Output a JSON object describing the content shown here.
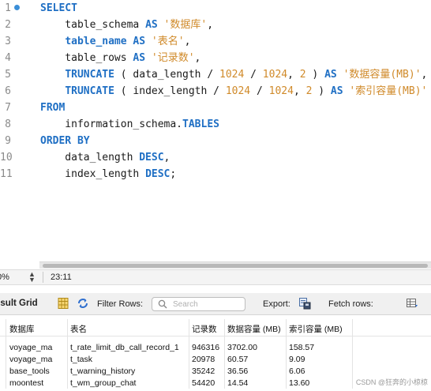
{
  "editor": {
    "lines": [
      {
        "n": "1",
        "breakpoint": true,
        "tokens": [
          {
            "t": "kw",
            "v": "SELECT"
          }
        ]
      },
      {
        "n": "2",
        "tokens": [
          {
            "t": "p",
            "v": "    table_schema "
          },
          {
            "t": "kw",
            "v": "AS"
          },
          {
            "t": "p",
            "v": " "
          },
          {
            "t": "str",
            "v": "'数据库'"
          },
          {
            "t": "p",
            "v": ","
          }
        ]
      },
      {
        "n": "3",
        "tokens": [
          {
            "t": "p",
            "v": "    "
          },
          {
            "t": "kw",
            "v": "table_name"
          },
          {
            "t": "p",
            "v": " "
          },
          {
            "t": "kw",
            "v": "AS"
          },
          {
            "t": "p",
            "v": " "
          },
          {
            "t": "str",
            "v": "'表名'"
          },
          {
            "t": "p",
            "v": ","
          }
        ]
      },
      {
        "n": "4",
        "tokens": [
          {
            "t": "p",
            "v": "    table_rows "
          },
          {
            "t": "kw",
            "v": "AS"
          },
          {
            "t": "p",
            "v": " "
          },
          {
            "t": "str",
            "v": "'记录数'"
          },
          {
            "t": "p",
            "v": ","
          }
        ]
      },
      {
        "n": "5",
        "tokens": [
          {
            "t": "p",
            "v": "    "
          },
          {
            "t": "fn",
            "v": "TRUNCATE"
          },
          {
            "t": "p",
            "v": " ( data_length / "
          },
          {
            "t": "num",
            "v": "1024"
          },
          {
            "t": "p",
            "v": " / "
          },
          {
            "t": "num",
            "v": "1024"
          },
          {
            "t": "p",
            "v": ", "
          },
          {
            "t": "num",
            "v": "2"
          },
          {
            "t": "p",
            "v": " ) "
          },
          {
            "t": "kw",
            "v": "AS"
          },
          {
            "t": "p",
            "v": " "
          },
          {
            "t": "str",
            "v": "'数据容量(MB)'"
          },
          {
            "t": "p",
            "v": ","
          }
        ]
      },
      {
        "n": "6",
        "tokens": [
          {
            "t": "p",
            "v": "    "
          },
          {
            "t": "fn",
            "v": "TRUNCATE"
          },
          {
            "t": "p",
            "v": " ( index_length / "
          },
          {
            "t": "num",
            "v": "1024"
          },
          {
            "t": "p",
            "v": " / "
          },
          {
            "t": "num",
            "v": "1024"
          },
          {
            "t": "p",
            "v": ", "
          },
          {
            "t": "num",
            "v": "2"
          },
          {
            "t": "p",
            "v": " ) "
          },
          {
            "t": "kw",
            "v": "AS"
          },
          {
            "t": "p",
            "v": " "
          },
          {
            "t": "str",
            "v": "'索引容量(MB)'"
          }
        ]
      },
      {
        "n": "7",
        "tokens": [
          {
            "t": "kw",
            "v": "FROM"
          }
        ]
      },
      {
        "n": "8",
        "tokens": [
          {
            "t": "p",
            "v": "    information_schema."
          },
          {
            "t": "kw",
            "v": "TABLES"
          }
        ]
      },
      {
        "n": "9",
        "tokens": [
          {
            "t": "kw",
            "v": "ORDER BY"
          }
        ]
      },
      {
        "n": "10",
        "tokens": [
          {
            "t": "p",
            "v": "    data_length "
          },
          {
            "t": "kw",
            "v": "DESC"
          },
          {
            "t": "p",
            "v": ","
          }
        ]
      },
      {
        "n": "11",
        "tokens": [
          {
            "t": "p",
            "v": "    index_length "
          },
          {
            "t": "kw",
            "v": "DESC"
          },
          {
            "t": "p",
            "v": ";"
          }
        ]
      }
    ]
  },
  "statusbar": {
    "zoom": "0%",
    "cursor": "23:11"
  },
  "toolbar": {
    "result_grid_label": "esult Grid",
    "filter_rows_label": "Filter Rows:",
    "search_placeholder": "Search",
    "export_label": "Export:",
    "fetch_rows_label": "Fetch rows:"
  },
  "grid": {
    "columns": [
      "数据库",
      "表名",
      "记录数",
      "数据容量 (MB)",
      "索引容量 (MB)"
    ],
    "rows": [
      [
        "voyage_ma",
        "t_rate_limit_db_call_record_1",
        "946316",
        "3702.00",
        "158.57"
      ],
      [
        "voyage_ma",
        "t_task",
        "20978",
        "60.57",
        "9.09"
      ],
      [
        "base_tools",
        "t_warning_history",
        "35242",
        "36.56",
        "6.06"
      ],
      [
        "moontest",
        "t_wm_group_chat",
        "54420",
        "14.54",
        "13.60"
      ]
    ]
  },
  "watermark": "CSDN @狂奔的小椋椋",
  "colors": {
    "keyword": "#1f6fc4",
    "string": "#d08a2a",
    "breakpoint": "#3b8fd8"
  }
}
